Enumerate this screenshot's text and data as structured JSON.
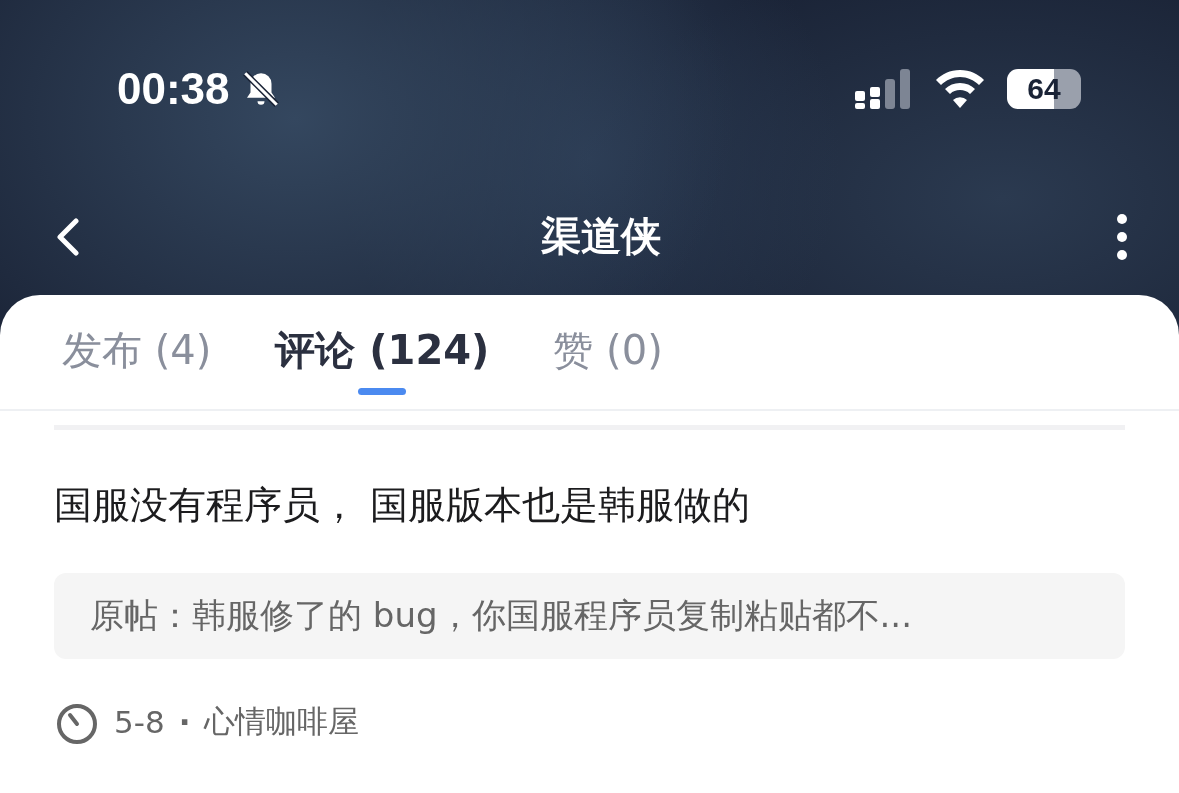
{
  "status_bar": {
    "time": "00:38",
    "battery": "64"
  },
  "nav": {
    "title": "渠道侠"
  },
  "tabs": [
    {
      "label": "发布 (4)",
      "selected": false
    },
    {
      "label": "评论 (124)",
      "selected": true
    },
    {
      "label": "赞 (0)",
      "selected": false
    }
  ],
  "comment": {
    "text": "国服没有程序员， 国服版本也是韩服做的",
    "quote": "原帖：韩服修了的 bug，你国服程序员复制粘贴都不...",
    "date": "5-8",
    "separator": "·",
    "forum": "心情咖啡屋"
  }
}
